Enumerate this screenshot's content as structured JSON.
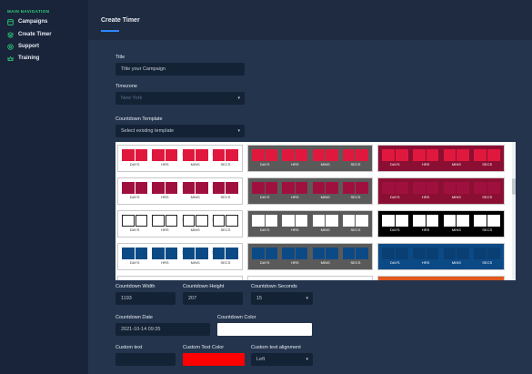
{
  "sidebar": {
    "heading": "MAIN NAVIGATION",
    "items": [
      {
        "label": "Campaigns",
        "icon": "campaigns-icon"
      },
      {
        "label": "Create Timer",
        "icon": "create-timer-icon"
      },
      {
        "label": "Support",
        "icon": "support-icon"
      },
      {
        "label": "Training",
        "icon": "training-icon"
      }
    ]
  },
  "header": {
    "title": "Create Timer"
  },
  "form": {
    "title_label": "Title",
    "title_value": "Title your Campaign",
    "timezone_label": "Timezone",
    "timezone_value": "New York",
    "template_label": "Countdown Template",
    "template_value": "Select existing template",
    "width_label": "Countdown Width",
    "width_value": "1193",
    "height_label": "Countdown Height",
    "height_value": "207",
    "seconds_label": "Countdown Seconds",
    "seconds_value": "15",
    "date_label": "Countdown Date",
    "date_value": "2021-10-14 09:35",
    "color_label": "Countdown Color",
    "color_value": "#ffffff",
    "text_label": "Custom text",
    "text_value": "",
    "text_color_label": "Custom Text Color",
    "text_color_value": "#ff0000",
    "alignment_label": "Custom text alignment",
    "alignment_value": "Left"
  },
  "template_captions": [
    "DAYS",
    "HRS",
    "MINS",
    "SECS"
  ],
  "colors": {
    "accent_green": "#2ed47a",
    "accent_blue": "#2f86ff",
    "red": "#e0183d",
    "crimson": "#a0103e",
    "navy": "#0c4a86",
    "grey_bg": "#5a5a5a",
    "maroon_bg": "#8a0f33",
    "orange": "#e2571e"
  }
}
